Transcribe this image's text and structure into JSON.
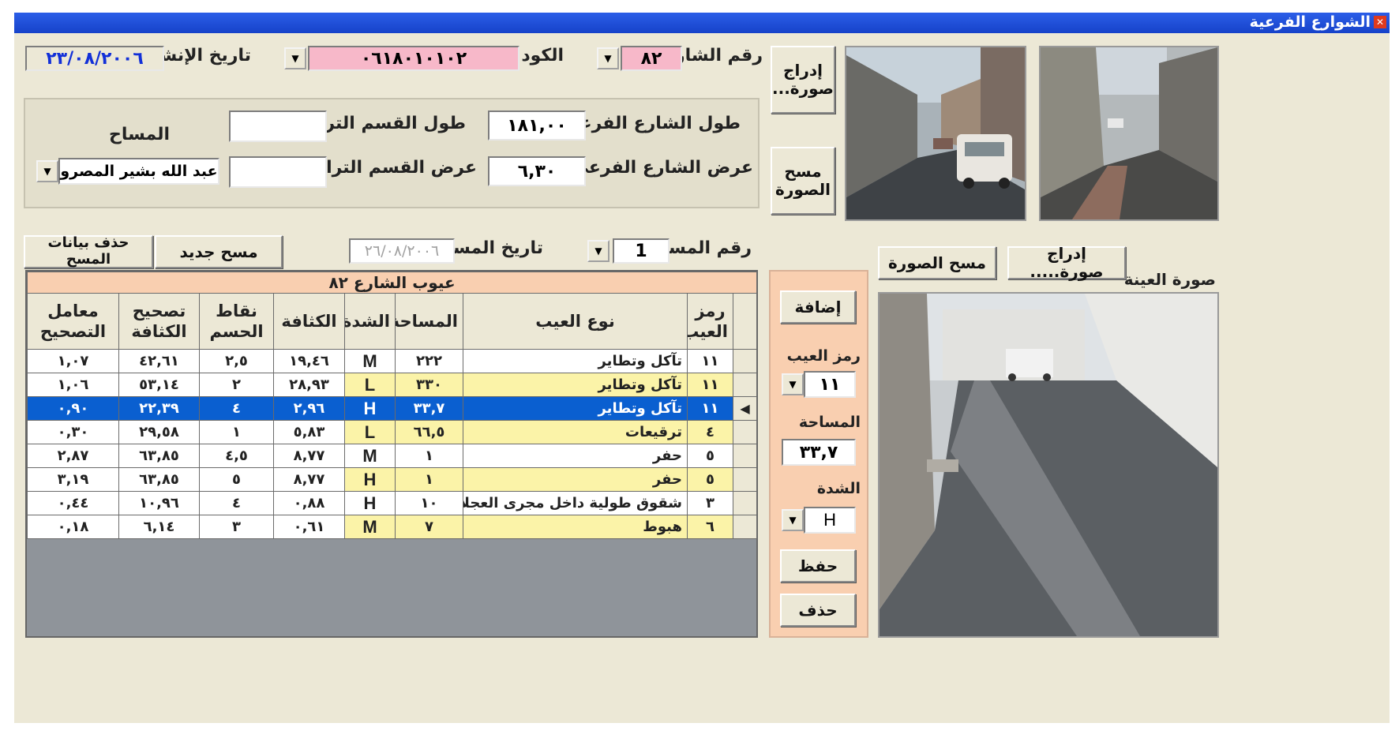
{
  "window": {
    "title": "الشوارع الفرعية",
    "close": "✕"
  },
  "header": {
    "street_no_label": "رقم الشارع",
    "street_no_value": "٨٢",
    "code_label": "الكود",
    "code_value": "٠٦١٨٠١٠١٠٢",
    "created_label": "تاريخ الإنشاء",
    "created_value": "٢٣/٠٨/٢٠٠٦"
  },
  "dims": {
    "len_label": "طول الشارع الفرعي",
    "len_value": "١٨١,٠٠",
    "width_label": "عرض الشارع الفرعي",
    "width_value": "٦,٣٠",
    "dirt_len_label": "طول القسم الترابي",
    "dirt_len_value": "",
    "dirt_width_label": "عرض القسم الترابي",
    "dirt_width_value": "",
    "surveyor_label": "المساح",
    "surveyor_value": "عبد الله بشير المصرو"
  },
  "photo_buttons": {
    "insert": "إدراج صورة...",
    "clear": "مسح الصورة"
  },
  "survey": {
    "no_label": "رقم المسح",
    "no_value": "1",
    "date_label": "تاريخ المسح",
    "date_value": "٢٦/٠٨/٢٠٠٦",
    "new_button": "مسح جديد",
    "delete_button": "حذف بيانات المسح"
  },
  "sample": {
    "label": "صورة العينة",
    "insert_button": "إدراج صورة.....",
    "clear_button": "مسح الصورة"
  },
  "defects": {
    "caption": "عيوب الشارع ٨٢",
    "headers": {
      "code": "رمز العيب",
      "type": "نوع العيب",
      "area": "المساحة",
      "severity": "الشدة",
      "density": "الكثافة",
      "deduct": "نقاط الحسم",
      "corr_density": "تصحيح الكثافة",
      "corr_factor": "معامل التصحيح"
    },
    "rows": [
      {
        "code": "١١",
        "type": "تآكل وتطاير",
        "area": "٢٢٢",
        "severity": "M",
        "density": "١٩,٤٦",
        "deduct": "٢,٥",
        "corr_density": "٤٢,٦١",
        "corr_factor": "١,٠٧"
      },
      {
        "code": "١١",
        "type": "تآكل وتطاير",
        "area": "٣٣٠",
        "severity": "L",
        "density": "٢٨,٩٣",
        "deduct": "٢",
        "corr_density": "٥٣,١٤",
        "corr_factor": "١,٠٦"
      },
      {
        "code": "١١",
        "type": "تآكل وتطاير",
        "area": "٣٣,٧",
        "severity": "H",
        "density": "٢,٩٦",
        "deduct": "٤",
        "corr_density": "٢٢,٣٩",
        "corr_factor": "٠,٩٠"
      },
      {
        "code": "٤",
        "type": "ترقيعات",
        "area": "٦٦,٥",
        "severity": "L",
        "density": "٥,٨٣",
        "deduct": "١",
        "corr_density": "٢٩,٥٨",
        "corr_factor": "٠,٣٠"
      },
      {
        "code": "٥",
        "type": "حفر",
        "area": "١",
        "severity": "M",
        "density": "٨,٧٧",
        "deduct": "٤,٥",
        "corr_density": "٦٣,٨٥",
        "corr_factor": "٢,٨٧"
      },
      {
        "code": "٥",
        "type": "حفر",
        "area": "١",
        "severity": "H",
        "density": "٨,٧٧",
        "deduct": "٥",
        "corr_density": "٦٣,٨٥",
        "corr_factor": "٣,١٩"
      },
      {
        "code": "٣",
        "type": "شقوق طولية داخل مجرى العجلات",
        "area": "١٠",
        "severity": "H",
        "density": "٠,٨٨",
        "deduct": "٤",
        "corr_density": "١٠,٩٦",
        "corr_factor": "٠,٤٤"
      },
      {
        "code": "٦",
        "type": "هبوط",
        "area": "٧",
        "severity": "M",
        "density": "٠,٦١",
        "deduct": "٣",
        "corr_density": "٦,١٤",
        "corr_factor": "٠,١٨"
      }
    ],
    "selected_row": 2
  },
  "editor": {
    "add_button": "إضافة",
    "code_label": "رمز العيب",
    "code_value": "١١",
    "area_label": "المساحة",
    "area_value": "٣٣,٧",
    "severity_label": "الشدة",
    "severity_value": "H",
    "save_button": "حفظ",
    "delete_button": "حذف"
  },
  "colors": {
    "titlebar": "#1642c9",
    "selected_row": "#0a5fd0",
    "pink_field": "#f7b8c9",
    "yellow_cell": "#fbf3a8",
    "salmon_panel": "#f9cfb0"
  }
}
